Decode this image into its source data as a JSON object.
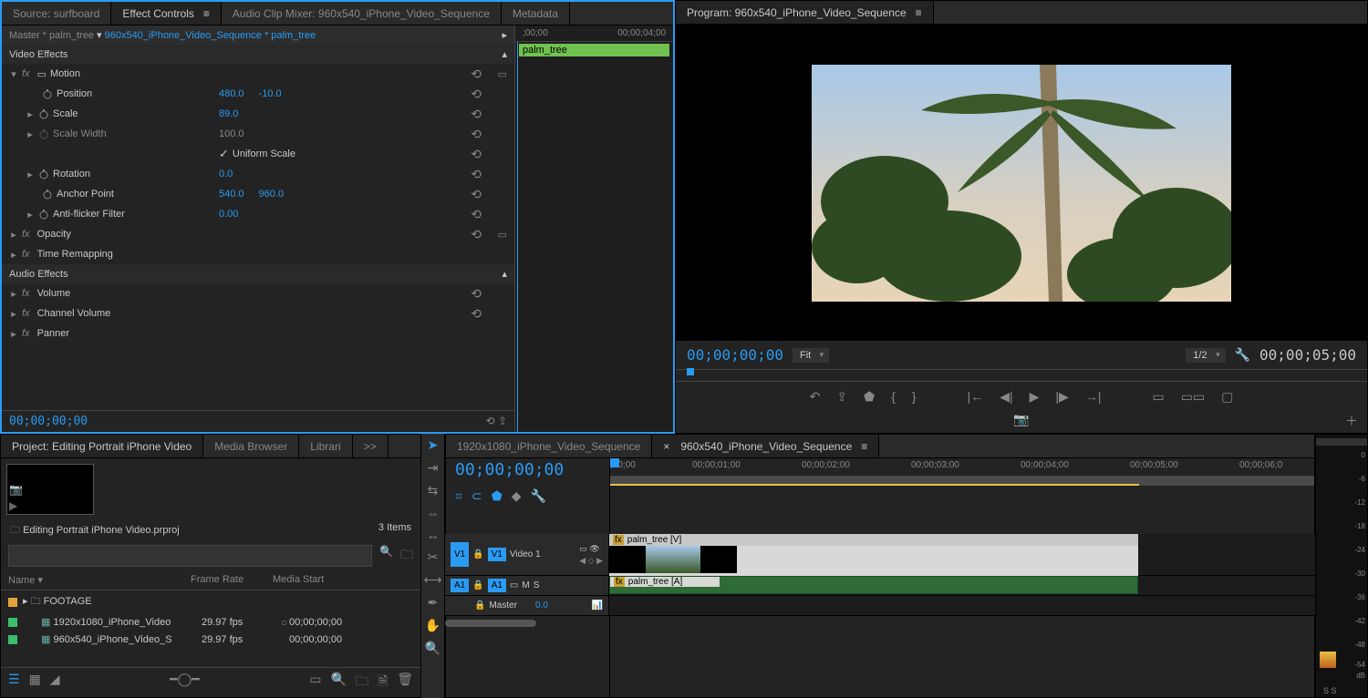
{
  "topTabs": {
    "left": [
      "Source: surfboard",
      "Effect Controls",
      "Audio Clip Mixer: 960x540_iPhone_Video_Sequence",
      "Metadata"
    ],
    "activeIndex": 1
  },
  "effectControls": {
    "crumb_master": "Master * palm_tree",
    "crumb_seq": "960x540_iPhone_Video_Sequence * palm_tree",
    "timeline": {
      "start": ";00;00",
      "end": "00;00;04;00",
      "clipName": "palm_tree"
    },
    "videoSection": "Video Effects",
    "audioSection": "Audio Effects",
    "motion": {
      "label": "Motion",
      "position": {
        "label": "Position",
        "x": "480.0",
        "y": "-10.0"
      },
      "scale": {
        "label": "Scale",
        "v": "89.0"
      },
      "scaleWidth": {
        "label": "Scale Width",
        "v": "100.0"
      },
      "uniform": {
        "label": "Uniform Scale",
        "checked": true
      },
      "rotation": {
        "label": "Rotation",
        "v": "0.0"
      },
      "anchor": {
        "label": "Anchor Point",
        "x": "540.0",
        "y": "960.0"
      },
      "antiFlicker": {
        "label": "Anti-flicker Filter",
        "v": "0.00"
      }
    },
    "opacity": "Opacity",
    "timeRemap": "Time Remapping",
    "volume": "Volume",
    "channelVolume": "Channel Volume",
    "panner": "Panner",
    "timecode": "00;00;00;00"
  },
  "program": {
    "title": "Program: 960x540_iPhone_Video_Sequence",
    "tcIn": "00;00;00;00",
    "tcOut": "00;00;05;00",
    "fit": "Fit",
    "res": "1/2",
    "buttons": [
      "undo",
      "export",
      "marker",
      "in",
      "out",
      "goto-in",
      "step-back",
      "play",
      "step-fwd",
      "goto-out",
      "lift",
      "extract",
      "safe"
    ],
    "camera": "camera"
  },
  "project": {
    "tab": "Project: Editing Portrait iPhone Video",
    "tabs": [
      "Media Browser",
      "Librari"
    ],
    "overflow": ">>",
    "file": "Editing Portrait iPhone Video.prproj",
    "itemCount": "3 Items",
    "searchPlaceholder": "",
    "cols": [
      "Name",
      "Frame Rate",
      "Media Start"
    ],
    "rows": [
      {
        "swatch": "#e2a23c",
        "icon": "folder",
        "name": "FOOTAGE",
        "fps": "",
        "start": ""
      },
      {
        "swatch": "#3cbf6a",
        "icon": "seq",
        "name": "1920x1080_iPhone_Video",
        "fps": "29.97 fps",
        "start": "00;00;00;00"
      },
      {
        "swatch": "#3cbf6a",
        "icon": "seq",
        "name": "960x540_iPhone_Video_S",
        "fps": "29.97 fps",
        "start": "00;00;00;00"
      }
    ]
  },
  "tools": [
    "select",
    "track-select",
    "ripple",
    "rolling",
    "rate",
    "razor",
    "slip",
    "slide",
    "pen",
    "hand",
    "zoom"
  ],
  "timeline": {
    "tabs": [
      {
        "name": "1920x1080_iPhone_Video_Sequence",
        "active": false
      },
      {
        "name": "960x540_iPhone_Video_Sequence",
        "active": true
      }
    ],
    "tc": "00;00;00;00",
    "iconRow": [
      "snap",
      "linked",
      "marker",
      "wrench"
    ],
    "ruler": [
      ";00;00",
      "00;00;01;00",
      "00;00;02;00",
      "00;00;03;00",
      "00;00;04;00",
      "00;00;05;00",
      "00;00;06;0"
    ],
    "v1": {
      "label": "V1",
      "name": "Video 1",
      "clip": "palm_tree [V]"
    },
    "a1": {
      "label": "A1",
      "clip": "palm_tree [A]",
      "m": "M",
      "s": "S"
    },
    "master": {
      "label": "Master",
      "v": "0.0"
    },
    "toggles": {
      "lock": "lock",
      "eye": "eye",
      "out": "out"
    }
  },
  "meter": {
    "marks": [
      "0",
      "-6",
      "-12",
      "-18",
      "-24",
      "-30",
      "-36",
      "-42",
      "-48",
      "-54",
      "dB"
    ],
    "ss": "S  S"
  }
}
